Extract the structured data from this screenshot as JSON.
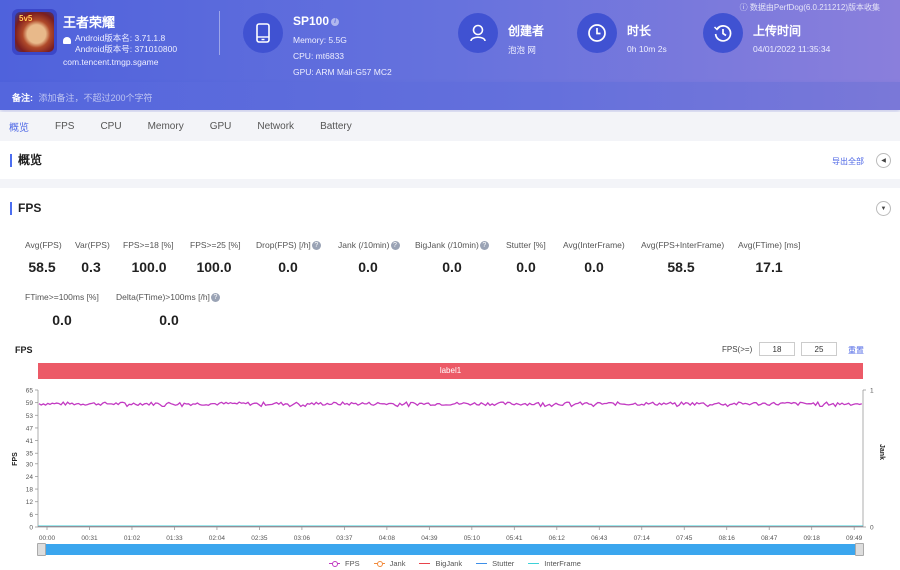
{
  "header": {
    "app": {
      "name": "王者荣耀",
      "android_version_name": "Android版本名: 3.71.1.8",
      "android_version_code": "Android版本号: 371010800",
      "package": "com.tencent.tmgp.sgame",
      "icon_badge": "5v5"
    },
    "device": {
      "name": "SP100",
      "memory": "Memory: 5.5G",
      "cpu": "CPU: mt6833",
      "gpu": "GPU: ARM Mali-G57 MC2"
    },
    "creator": {
      "title": "创建者",
      "value": "泡泡 网"
    },
    "duration": {
      "title": "时长",
      "value": "0h 10m 2s"
    },
    "upload": {
      "title": "上传时间",
      "value": "04/01/2022 11:35:34"
    },
    "collected_by": "数据由PerfDog(6.0.211212)版本收集",
    "note_label": "备注:",
    "note_placeholder": "添加备注，不超过200个字符"
  },
  "tabs": [
    {
      "label": "概览",
      "active": true
    },
    {
      "label": "FPS",
      "active": false
    },
    {
      "label": "CPU",
      "active": false
    },
    {
      "label": "Memory",
      "active": false
    },
    {
      "label": "GPU",
      "active": false
    },
    {
      "label": "Network",
      "active": false
    },
    {
      "label": "Battery",
      "active": false
    }
  ],
  "overview": {
    "title": "概览",
    "export_label": "导出全部"
  },
  "fps_section": {
    "title": "FPS",
    "metrics": [
      {
        "label": "Avg(FPS)",
        "value": "58.5",
        "help": false
      },
      {
        "label": "Var(FPS)",
        "value": "0.3",
        "help": false
      },
      {
        "label": "FPS>=18 [%]",
        "value": "100.0",
        "help": false
      },
      {
        "label": "FPS>=25 [%]",
        "value": "100.0",
        "help": false
      },
      {
        "label": "Drop(FPS) [/h]",
        "value": "0.0",
        "help": true
      },
      {
        "label": "Jank (/10min)",
        "value": "0.0",
        "help": true
      },
      {
        "label": "BigJank (/10min)",
        "value": "0.0",
        "help": true
      },
      {
        "label": "Stutter [%]",
        "value": "0.0",
        "help": false
      },
      {
        "label": "Avg(InterFrame)",
        "value": "0.0",
        "help": false
      },
      {
        "label": "Avg(FPS+InterFrame)",
        "value": "58.5",
        "help": false
      },
      {
        "label": "Avg(FTime) [ms]",
        "value": "17.1",
        "help": false
      },
      {
        "label": "FTime>=100ms [%]",
        "value": "0.0",
        "help": false
      },
      {
        "label": "Delta(FTime)>100ms [/h]",
        "value": "0.0",
        "help": true
      }
    ],
    "chart_controls": {
      "title": "FPS",
      "threshold_label": "FPS(>=)",
      "threshold_1": "18",
      "threshold_2": "25",
      "reset_label": "重置",
      "band_label": "label1"
    }
  },
  "chart_data": {
    "type": "line",
    "title": "FPS",
    "xlabel": "",
    "ylabel": "FPS",
    "y2label": "Jank",
    "x_ticks": [
      "00:00",
      "00:31",
      "01:02",
      "01:33",
      "02:04",
      "02:35",
      "03:06",
      "03:37",
      "04:08",
      "04:39",
      "05:10",
      "05:41",
      "06:12",
      "06:43",
      "07:14",
      "07:45",
      "08:16",
      "08:47",
      "09:18",
      "09:49"
    ],
    "y_ticks": [
      0,
      6,
      12,
      18,
      24,
      30,
      35,
      41,
      47,
      53,
      59,
      65
    ],
    "ylim": [
      0,
      65
    ],
    "y2_ticks": [
      0,
      1
    ],
    "y2lim": [
      0,
      1
    ],
    "duration_seconds": 602,
    "grid": false,
    "legend_position": "bottom",
    "series": [
      {
        "name": "FPS",
        "color": "#c23ac2",
        "marker": "circle",
        "typical_value": 58.5,
        "min_value": 57,
        "max_value": 60
      },
      {
        "name": "Jank",
        "color": "#f28b3c",
        "marker": "circle",
        "typical_value": 0
      },
      {
        "name": "BigJank",
        "color": "#e8434b",
        "marker": "none",
        "typical_value": 0
      },
      {
        "name": "Stutter",
        "color": "#3d8fe8",
        "marker": "none",
        "typical_value": 0
      },
      {
        "name": "InterFrame",
        "color": "#3dd1d8",
        "marker": "none",
        "typical_value": 0
      }
    ]
  }
}
